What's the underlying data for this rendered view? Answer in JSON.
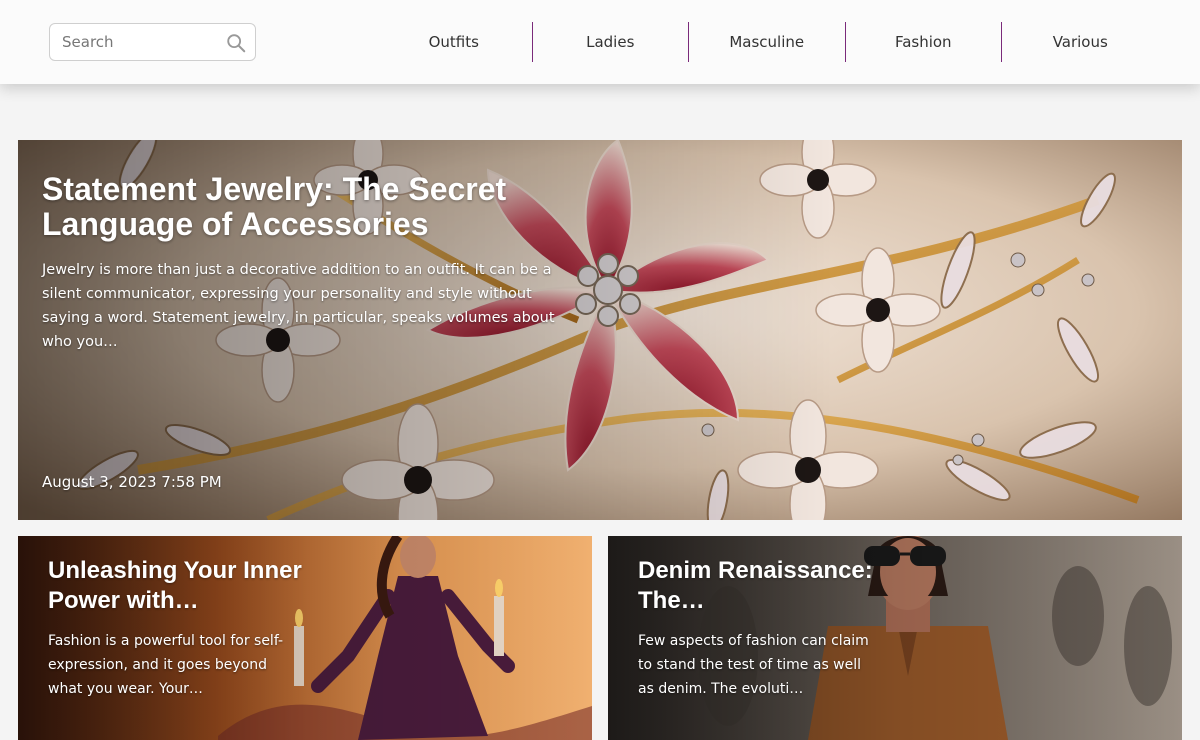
{
  "search": {
    "placeholder": "Search",
    "icon": "search-icon"
  },
  "nav": {
    "items": [
      {
        "label": "Outfits"
      },
      {
        "label": "Ladies"
      },
      {
        "label": "Masculine"
      },
      {
        "label": "Fashion"
      },
      {
        "label": "Various"
      }
    ]
  },
  "hero": {
    "title": "Statement Jewelry: The Secret Language of Accessories",
    "excerpt": "Jewelry is more than just a decorative addition to an outfit. It can be a silent communicator, expressing your personality and style without saying a word. Statement jewelry, in particular, speaks volumes about who you…",
    "date": "August 3, 2023 7:58 PM"
  },
  "cards": [
    {
      "title": "Unleashing Your Inner Power with…",
      "excerpt": "Fashion is a powerful tool for self-expression, and it goes beyond what you wear. Your…"
    },
    {
      "title": "Denim Renaissance: The…",
      "excerpt": "Few aspects of fashion can claim to stand the test of time as well as denim. The evoluti…"
    }
  ],
  "colors": {
    "nav_divider": "#7a2a7a",
    "header_bg": "#fbfbfb",
    "page_bg": "#f4f4f4"
  }
}
